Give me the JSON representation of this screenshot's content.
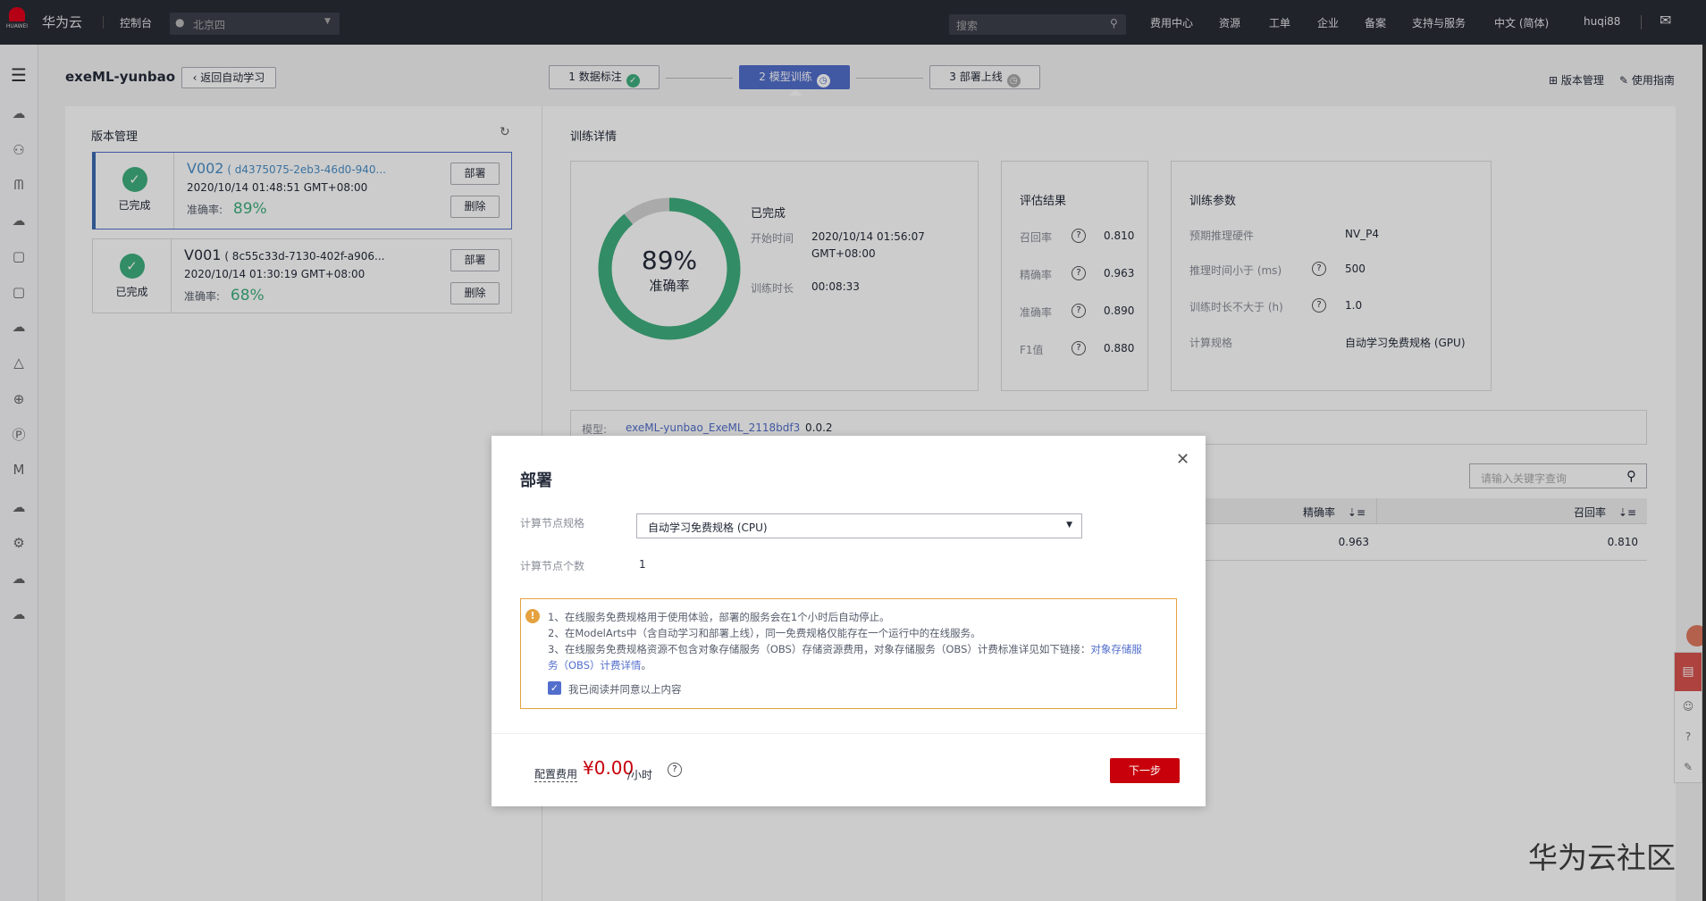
{
  "topbar": {
    "brand": "华为云",
    "logo_text": "HUAWEI",
    "console": "控制台",
    "region": "北京四",
    "search_placeholder": "搜索",
    "links": [
      "费用中心",
      "资源",
      "工单",
      "企业",
      "备案",
      "支持与服务",
      "中文 (简体)",
      "huqi88"
    ]
  },
  "sidebar": {
    "icons": [
      "menu-icon",
      "cloud-icon",
      "cluster-icon",
      "wave-icon",
      "cloud-icon",
      "document-icon",
      "document-icon",
      "cloud-icon",
      "pyramid-icon",
      "globe-icon",
      "ip-icon",
      "modelarts-icon",
      "cloud-icon",
      "gear-cloud-icon",
      "cloud-icon",
      "cloud-icon"
    ]
  },
  "header": {
    "title": "exeML-yunbao",
    "back": "返回自动学习",
    "steps": [
      {
        "label": "1 数据标注",
        "status": "done"
      },
      {
        "label": "2 模型训练",
        "status": "active"
      },
      {
        "label": "3 部署上线",
        "status": "pending"
      }
    ],
    "version_mgmt": "版本管理",
    "guide": "使用指南"
  },
  "versions": {
    "title": "版本管理",
    "items": [
      {
        "status": "已完成",
        "name": "V002",
        "id": "( d4375075-2eb3-46d0-940...",
        "time": "2020/10/14 01:48:51 GMT+08:00",
        "acc_label": "准确率:",
        "acc": "89%",
        "deploy": "部署",
        "delete": "删除"
      },
      {
        "status": "已完成",
        "name": "V001",
        "id": "( 8c55c33d-7130-402f-a906...",
        "time": "2020/10/14 01:30:19 GMT+08:00",
        "acc_label": "准确率:",
        "acc": "68%",
        "deploy": "部署",
        "delete": "删除"
      }
    ]
  },
  "training": {
    "title": "训练详情",
    "accuracy": "89%",
    "accuracy_value": 0.89,
    "accuracy_label": "准确率",
    "status": "已完成",
    "start_label": "开始时间",
    "start": "2020/10/14 01:56:07",
    "start_tz": "GMT+08:00",
    "duration_label": "训练时长",
    "duration": "00:08:33"
  },
  "eval": {
    "title": "评估结果",
    "rows": [
      {
        "k": "召回率",
        "v": "0.810"
      },
      {
        "k": "精确率",
        "v": "0.963"
      },
      {
        "k": "准确率",
        "v": "0.890"
      },
      {
        "k": "F1值",
        "v": "0.880"
      }
    ]
  },
  "params": {
    "title": "训练参数",
    "rows": [
      {
        "k": "预期推理硬件",
        "v": "NV_P4"
      },
      {
        "k": "推理时间小于 (ms)",
        "v": "500"
      },
      {
        "k": "训练时长不大于 (h)",
        "v": "1.0"
      },
      {
        "k": "计算规格",
        "v": "自动学习免费规格 (GPU)"
      }
    ]
  },
  "model": {
    "label": "模型:",
    "name": "exeML-yunbao_ExeML_2118bdf3",
    "version": "0.0.2"
  },
  "table": {
    "search_placeholder": "请输入关键字查询",
    "headers": [
      "精确率",
      "召回率"
    ],
    "rows": [
      [
        "0.963",
        "0.810"
      ]
    ]
  },
  "modal": {
    "title": "部署",
    "spec_label": "计算节点规格",
    "spec_value": "自动学习免费规格 (CPU)",
    "count_label": "计算节点个数",
    "count": "1",
    "notes": [
      "1、在线服务免费规格用于使用体验，部署的服务会在1个小时后自动停止。",
      "2、在ModelArts中（含自动学习和部署上线），同一免费规格仅能存在一个运行中的在线服务。",
      "3、在线服务免费规格资源不包含对象存储服务（OBS）存储资源费用，对象存储服务（OBS）计费标准详见如下链接："
    ],
    "link1": "对象存储服",
    "link2": "务（OBS）计费详情",
    "link_end": "。",
    "agree": "我已阅读并同意以上内容",
    "agree_checked": true,
    "fee_label": "配置费用",
    "fee": "¥0.00",
    "fee_unit": "/小时",
    "next": "下一步"
  },
  "watermark": "华为云社区",
  "colors": {
    "accent": "#526ecc",
    "success": "#3fb07f",
    "danger": "#c7000b",
    "warning": "#e5a23e"
  }
}
